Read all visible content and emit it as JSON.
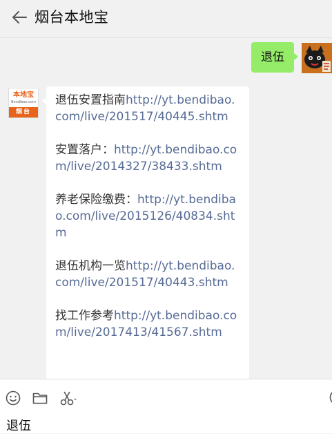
{
  "header": {
    "title": "烟台本地宝",
    "back_icon": "back-arrow-icon"
  },
  "messages": {
    "me": {
      "text": "退伍",
      "bubble_color": "#95ec69"
    },
    "bot": {
      "avatar": {
        "brand": "本地宝",
        "domain": "Bendibao.com",
        "city": "烟台",
        "color": "#e8641b"
      },
      "entries": [
        {
          "prefix": "退伍安置指南",
          "link": "http://yt.bendibao.com/live/201517/40445.shtm"
        },
        {
          "prefix": "安置落户：",
          "link": "http://yt.bendibao.com/live/2014327/38433.shtm"
        },
        {
          "prefix": "养老保险缴费：",
          "link": "http://yt.bendibao.com/live/2015126/40834.shtm"
        },
        {
          "prefix": "退伍机构一览",
          "link": "http://yt.bendibao.com/live/201517/40443.shtm"
        },
        {
          "prefix": "找工作参考",
          "link": "http://yt.bendibao.com/live/2017413/41567.shtm"
        }
      ],
      "link_color": "#576b95"
    }
  },
  "input": {
    "text": "退伍",
    "tools": [
      "emoji-icon",
      "folder-icon",
      "scissors-icon"
    ]
  }
}
